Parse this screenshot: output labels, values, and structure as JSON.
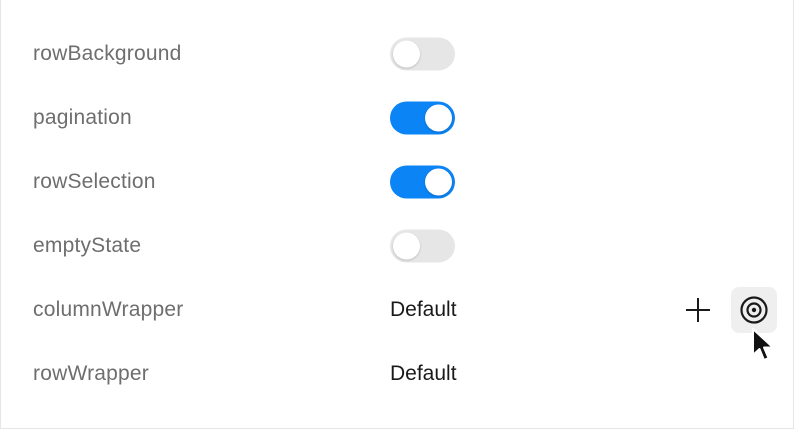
{
  "properties": [
    {
      "label": "rowBackground",
      "type": "toggle",
      "checked": false
    },
    {
      "label": "pagination",
      "type": "toggle",
      "checked": true
    },
    {
      "label": "rowSelection",
      "type": "toggle",
      "checked": true
    },
    {
      "label": "emptyState",
      "type": "toggle",
      "checked": false
    },
    {
      "label": "columnWrapper",
      "type": "value",
      "value": "Default",
      "actions": [
        "plus-icon",
        "target-icon"
      ]
    },
    {
      "label": "rowWrapper",
      "type": "value",
      "value": "Default"
    }
  ],
  "colors": {
    "toggle_on": "#0b84f5",
    "toggle_off": "#e6e6e6",
    "label": "#6e6e6e",
    "value": "#1a1a1a"
  }
}
